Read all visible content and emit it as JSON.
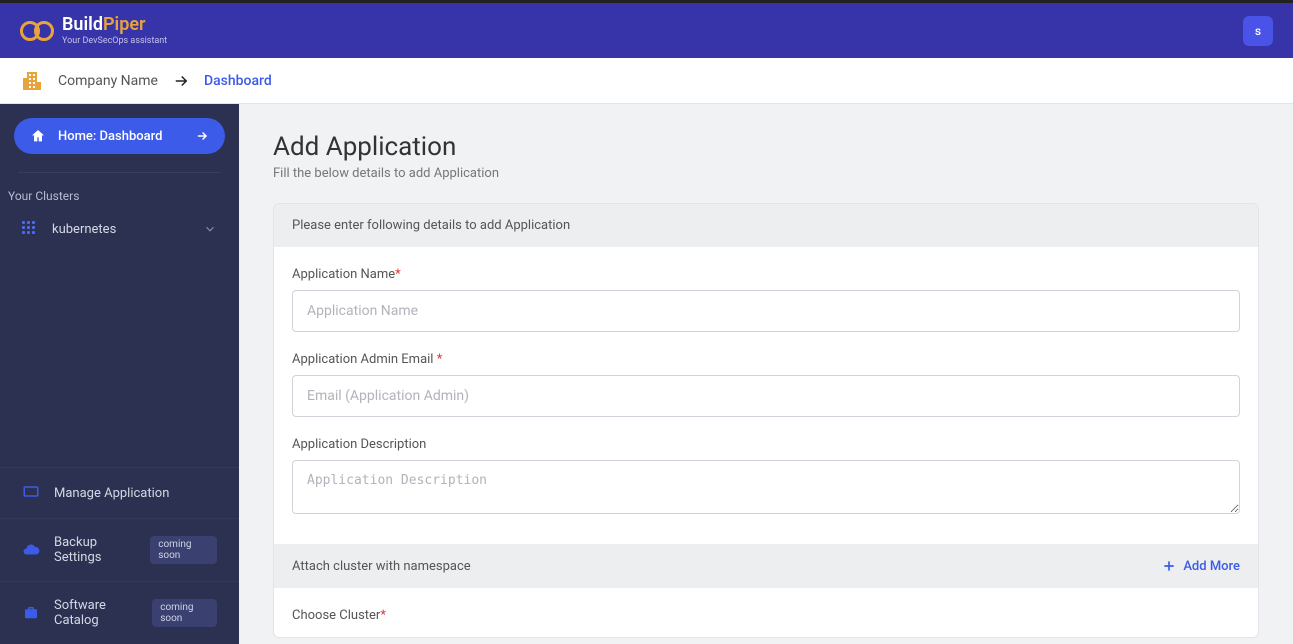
{
  "brand": {
    "part1": "Build",
    "part2": "Piper",
    "tagline": "Your DevSecOps assistant"
  },
  "user": {
    "initial": "s"
  },
  "breadcrumb": {
    "company": "Company Name",
    "current": "Dashboard"
  },
  "sidebar": {
    "home_label": "Home: Dashboard",
    "clusters_title": "Your Clusters",
    "clusters": [
      {
        "name": "kubernetes"
      }
    ],
    "nav": {
      "manage_app": "Manage Application",
      "backup": "Backup Settings",
      "catalog": "Software Catalog",
      "badge": "coming soon"
    }
  },
  "page": {
    "title": "Add Application",
    "subtitle": "Fill the below details to add Application",
    "card_head": "Please enter following details to add Application",
    "fields": {
      "name_label": "Application Name",
      "name_placeholder": "Application Name",
      "email_label": "Application Admin Email ",
      "email_placeholder": "Email (Application Admin)",
      "desc_label": "Application Description",
      "desc_placeholder": "Application Description"
    },
    "attach_section": "Attach cluster with namespace",
    "add_more": "Add More",
    "choose_cluster_label": "Choose Cluster"
  }
}
